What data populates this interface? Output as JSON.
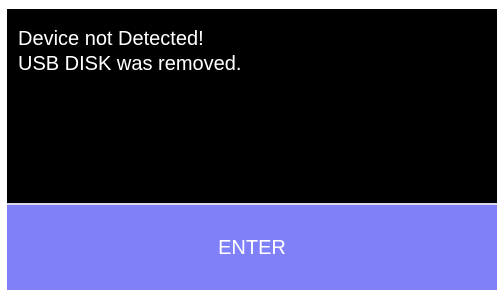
{
  "dialog": {
    "message_line_1": "Device not Detected!",
    "message_line_2": "USB DISK was removed.",
    "enter_label": "ENTER"
  },
  "colors": {
    "message_background": "#000000",
    "message_text": "#ffffff",
    "button_background": "#8080f8",
    "button_text": "#ffffff"
  }
}
